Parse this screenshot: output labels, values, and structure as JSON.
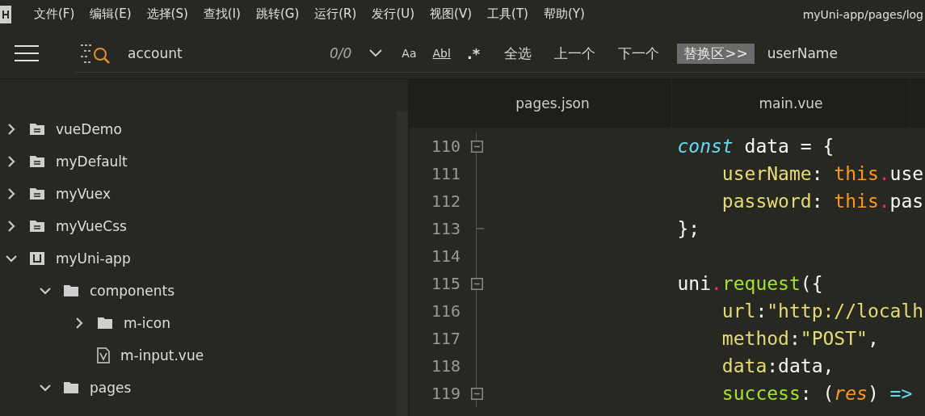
{
  "menu_bar": {
    "items": [
      "文件(F)",
      "编辑(E)",
      "选择(S)",
      "查找(I)",
      "跳转(G)",
      "运行(R)",
      "发行(U)",
      "视图(V)",
      "工具(T)",
      "帮助(Y)"
    ],
    "title": "myUni-app/pages/log"
  },
  "find_bar": {
    "value": "account",
    "count": "0/0",
    "options": [
      {
        "label": "Aa",
        "kind": "case"
      },
      {
        "label": "Abl",
        "kind": "word"
      },
      {
        "label": ".*",
        "kind": "regex"
      }
    ],
    "actions": [
      "全选",
      "上一个",
      "下一个"
    ],
    "replace_toggle": "替换区>>",
    "replace_value": "userName"
  },
  "tree": [
    {
      "label": "vueDemo",
      "kind": "project",
      "expanded": false
    },
    {
      "label": "myDefault",
      "kind": "project",
      "expanded": false
    },
    {
      "label": "myVuex",
      "kind": "project",
      "expanded": false
    },
    {
      "label": "myVueCss",
      "kind": "project",
      "expanded": false
    },
    {
      "label": "myUni-app",
      "kind": "uni",
      "expanded": true,
      "children": [
        {
          "label": "components",
          "kind": "folder",
          "expanded": true,
          "children": [
            {
              "label": "m-icon",
              "kind": "folder",
              "expanded": false
            },
            {
              "label": "m-input.vue",
              "kind": "vue"
            }
          ]
        },
        {
          "label": "pages",
          "kind": "folder",
          "expanded": true
        }
      ]
    }
  ],
  "tabs": [
    {
      "label": "pages.json",
      "selected": false
    },
    {
      "label": "main.vue",
      "selected": false
    }
  ],
  "code": [
    {
      "number": "110",
      "foldable": true,
      "tokens": [
        {
          "text": "const",
          "kind": "keyword"
        },
        {
          "text": " data = {",
          "kind": "plain"
        }
      ],
      "children": [
        {
          "number": "111",
          "foldable": false,
          "tokens": [
            {
              "text": "userName",
              "kind": "property"
            },
            {
              "text": ": ",
              "kind": "plain"
            },
            {
              "text": "this",
              "kind": "this"
            },
            {
              "text": ".",
              "kind": "dot"
            },
            {
              "text": "use",
              "kind": "plain"
            }
          ]
        },
        {
          "number": "112",
          "foldable": false,
          "tokens": [
            {
              "text": "password",
              "kind": "property"
            },
            {
              "text": ": ",
              "kind": "plain"
            },
            {
              "text": "this",
              "kind": "this"
            },
            {
              "text": ".",
              "kind": "dot"
            },
            {
              "text": "pas",
              "kind": "plain"
            }
          ]
        }
      ]
    },
    {
      "number": "113",
      "foldable": false,
      "tokens": [
        {
          "text": "};",
          "kind": "plain"
        }
      ]
    },
    {
      "number": "114",
      "foldable": false
    },
    {
      "number": "115",
      "foldable": true,
      "tokens": [
        {
          "text": "uni",
          "kind": "plain"
        },
        {
          "text": ".",
          "kind": "dot"
        },
        {
          "text": "request",
          "kind": "method"
        },
        {
          "text": "({",
          "kind": "plain"
        }
      ],
      "children": [
        {
          "number": "116",
          "foldable": false,
          "tokens": [
            {
              "text": "url",
              "kind": "property"
            },
            {
              "text": ":",
              "kind": "plain"
            },
            {
              "text": "\"http://localh",
              "kind": "string"
            }
          ]
        },
        {
          "number": "117",
          "foldable": false,
          "tokens": [
            {
              "text": "method",
              "kind": "property"
            },
            {
              "text": ":",
              "kind": "plain"
            },
            {
              "text": "\"POST\"",
              "kind": "string"
            },
            {
              "text": ",",
              "kind": "plain"
            }
          ]
        },
        {
          "number": "118",
          "foldable": false,
          "tokens": [
            {
              "text": "data",
              "kind": "property"
            },
            {
              "text": ":data,",
              "kind": "plain"
            }
          ]
        },
        {
          "number": "119",
          "foldable": true,
          "tokens": [
            {
              "text": "success",
              "kind": "method"
            },
            {
              "text": ": (",
              "kind": "plain"
            },
            {
              "text": "res",
              "kind": "param"
            },
            {
              "text": ") ",
              "kind": "plain"
            },
            {
              "text": "=>",
              "kind": "arrow"
            }
          ]
        }
      ]
    }
  ]
}
